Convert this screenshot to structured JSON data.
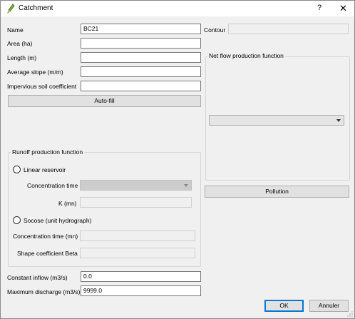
{
  "window": {
    "title": "Catchment",
    "help_label": "?",
    "close_label": "✕",
    "icon": "pencil-icon"
  },
  "form": {
    "name_label": "Name",
    "name_value": "BC21",
    "area_label": "Area (ha)",
    "area_value": "",
    "length_label": "Length (m)",
    "length_value": "",
    "slope_label": "Average slope (m/m)",
    "slope_value": "",
    "impervious_label": "Impervious soil coefficient",
    "impervious_value": "",
    "autofill_label": "Auto-fill",
    "contour_label": "Contour",
    "contour_value": ""
  },
  "net_flow": {
    "title": "Net flow production function",
    "selected": ""
  },
  "pollution_label": "Pollution",
  "runoff": {
    "title": "Runoff production function",
    "linear_reservoir_label": "Linear reservoir",
    "concentration_time_label": "Concentration time",
    "concentration_time_value": "",
    "k_label": "K (mn)",
    "k_value": "",
    "socose_label": "Socose (unit hydrograph)",
    "concentration_time_mn_label": "Concentration time (mn)",
    "concentration_time_mn_value": "",
    "shape_coeff_label": "Shape coefficient Beta",
    "shape_coeff_value": ""
  },
  "bottom": {
    "constant_inflow_label": "Constant inflow (m3/s)",
    "constant_inflow_value": "0.0",
    "max_discharge_label": "Maximum discharge (m3/s)",
    "max_discharge_value": "9999.0",
    "ok_label": "OK",
    "cancel_label": "Annuler"
  }
}
